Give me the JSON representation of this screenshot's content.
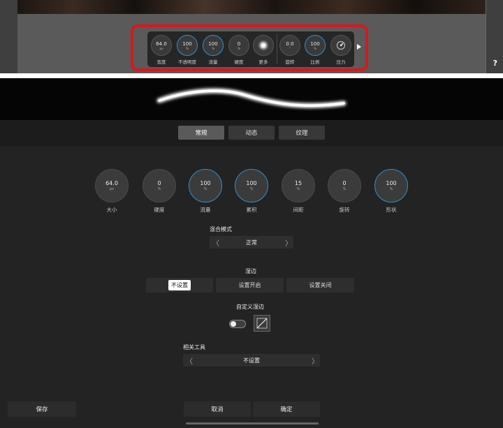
{
  "toolbar": {
    "knobs": [
      {
        "value": "64.0",
        "unit": "px",
        "label": "宽度",
        "ring": "none"
      },
      {
        "value": "100",
        "unit": "%",
        "label": "不透明度",
        "ring": "blue"
      },
      {
        "value": "100",
        "unit": "%",
        "label": "流量",
        "ring": "blue"
      },
      {
        "value": "0",
        "unit": "%",
        "label": "硬度",
        "ring": "none"
      },
      {
        "value": "",
        "unit": "",
        "label": "更多",
        "ring": "none"
      },
      {
        "value": "0.0",
        "unit": "°",
        "label": "旋转",
        "ring": "none"
      },
      {
        "value": "100",
        "unit": "%",
        "label": "比例",
        "ring": "blue"
      },
      {
        "value": "",
        "unit": "",
        "label": "压力",
        "ring": "none"
      }
    ],
    "more_icon": "soft-brush-dot-icon",
    "pressure_icon": "pressure-gauge-icon",
    "expand_icon": "play-arrow-icon"
  },
  "help_label": "?",
  "tabs": [
    {
      "label": "常规",
      "active": true
    },
    {
      "label": "动态",
      "active": false
    },
    {
      "label": "纹理",
      "active": false
    }
  ],
  "knobs": [
    {
      "value": "64.0",
      "unit": "px",
      "label": "大小",
      "ring": "none"
    },
    {
      "value": "0",
      "unit": "%",
      "label": "硬度",
      "ring": "none"
    },
    {
      "value": "100",
      "unit": "%",
      "label": "流量",
      "ring": "blue"
    },
    {
      "value": "100",
      "unit": "%",
      "label": "累积",
      "ring": "blue"
    },
    {
      "value": "15",
      "unit": "%",
      "label": "间距",
      "ring": "none"
    },
    {
      "value": "0",
      "unit": "%",
      "label": "旋转",
      "ring": "none"
    },
    {
      "value": "100",
      "unit": "%",
      "label": "形状",
      "ring": "blue"
    }
  ],
  "blend": {
    "title": "混合模式",
    "value": "正常",
    "prev": "〈",
    "next": "〉"
  },
  "wet_edge": {
    "title": "湿边",
    "options": [
      {
        "label": "不设置",
        "active": true
      },
      {
        "label": "设置开启",
        "active": false
      },
      {
        "label": "设置关闭",
        "active": false
      }
    ]
  },
  "custom_wet_edge": {
    "title": "自定义湿边",
    "toggle_on": false,
    "curve_icon": "diagonal-curve-icon"
  },
  "related_tool": {
    "title": "相关工具",
    "value": "不设置",
    "prev": "〈",
    "next": "〉"
  },
  "footer": {
    "save": "保存",
    "cancel": "取消",
    "confirm": "确定"
  },
  "colors": {
    "accent_ring": "#2f8fd6",
    "highlight_box": "#d9171c"
  }
}
